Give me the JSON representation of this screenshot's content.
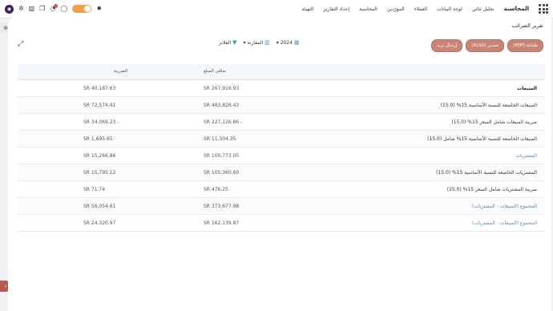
{
  "navbar": {
    "brand": "المحاسبة",
    "menu": [
      "لوحة البيانات",
      "العملاء",
      "المورّدين",
      "المحاسبة",
      "إعداد التقارير",
      "التهيئة"
    ],
    "menu_lead": "تحليل ثنائي"
  },
  "page": {
    "title": "تقرير الضرائب"
  },
  "buttons": {
    "pdf": "طباعة (PDF)",
    "xlsx": "تصدير (XLSX)",
    "send": "إرسال بريد"
  },
  "filters": {
    "year": "2024",
    "comparison": "المقارنة",
    "filter": "الفلاتر"
  },
  "table": {
    "headers": {
      "net": "صافي المبلغ",
      "tax": "الضريبة"
    },
    "rows": [
      {
        "label": "المبيعات",
        "net": "SR 267,916.93",
        "tax": "SR 40,187.63",
        "style": "bold"
      },
      {
        "label": "المبيعات الخاضعة للنسبة الأساسية 15% (15.0)",
        "net": "SR 483,826.43",
        "tax": "SR 72,574.41",
        "style": "normal"
      },
      {
        "label": "ضريبة المبيعات شامل السعر 15% (15.0)",
        "net": "SR 227,126.86 -",
        "tax": "SR 34,069.23 -",
        "style": "normal"
      },
      {
        "label": "المبيعات الخاضعة للنسبة الأساسية 15% شامل (15.0)",
        "net": "SR 11,304.35",
        "tax": "SR 1,695.65",
        "style": "normal"
      },
      {
        "label": "المشتريات",
        "net": "SR 100,773.05",
        "tax": "SR 15,266.86",
        "style": "link"
      },
      {
        "label": "المشتريات الخاضعة للنسبة الأساسية 15% (15.0)",
        "net": "SR 105,360.60",
        "tax": "SR 15,795.12",
        "style": "normal"
      },
      {
        "label": "ضريبة المشتريات شامل السعر 15% (15.0)",
        "net": "SR 476.25",
        "tax": "SR 71.74",
        "style": "normal"
      },
      {
        "label": "المجموع (المبيعات - المشتريات)",
        "net": "SR 373,677.98",
        "tax": "SR 56,054.61",
        "style": "link"
      },
      {
        "label": "المجموع (المبيعات - المشتريات)",
        "net": "SR 162,139.87",
        "tax": "SR 24,320.97",
        "style": "link"
      }
    ]
  },
  "icons": {
    "apps": "grid-icon",
    "bug": "bug-icon",
    "chat": "chat-icon",
    "calendar": "calendar-icon",
    "filter": "filter-icon",
    "chart": "chart-icon",
    "expand": "expand-icon",
    "zoom": "zoom-icon"
  },
  "colors": {
    "accent": "#c98476",
    "toggle": "#f29f4b",
    "avatar": "#3b1d5c"
  }
}
